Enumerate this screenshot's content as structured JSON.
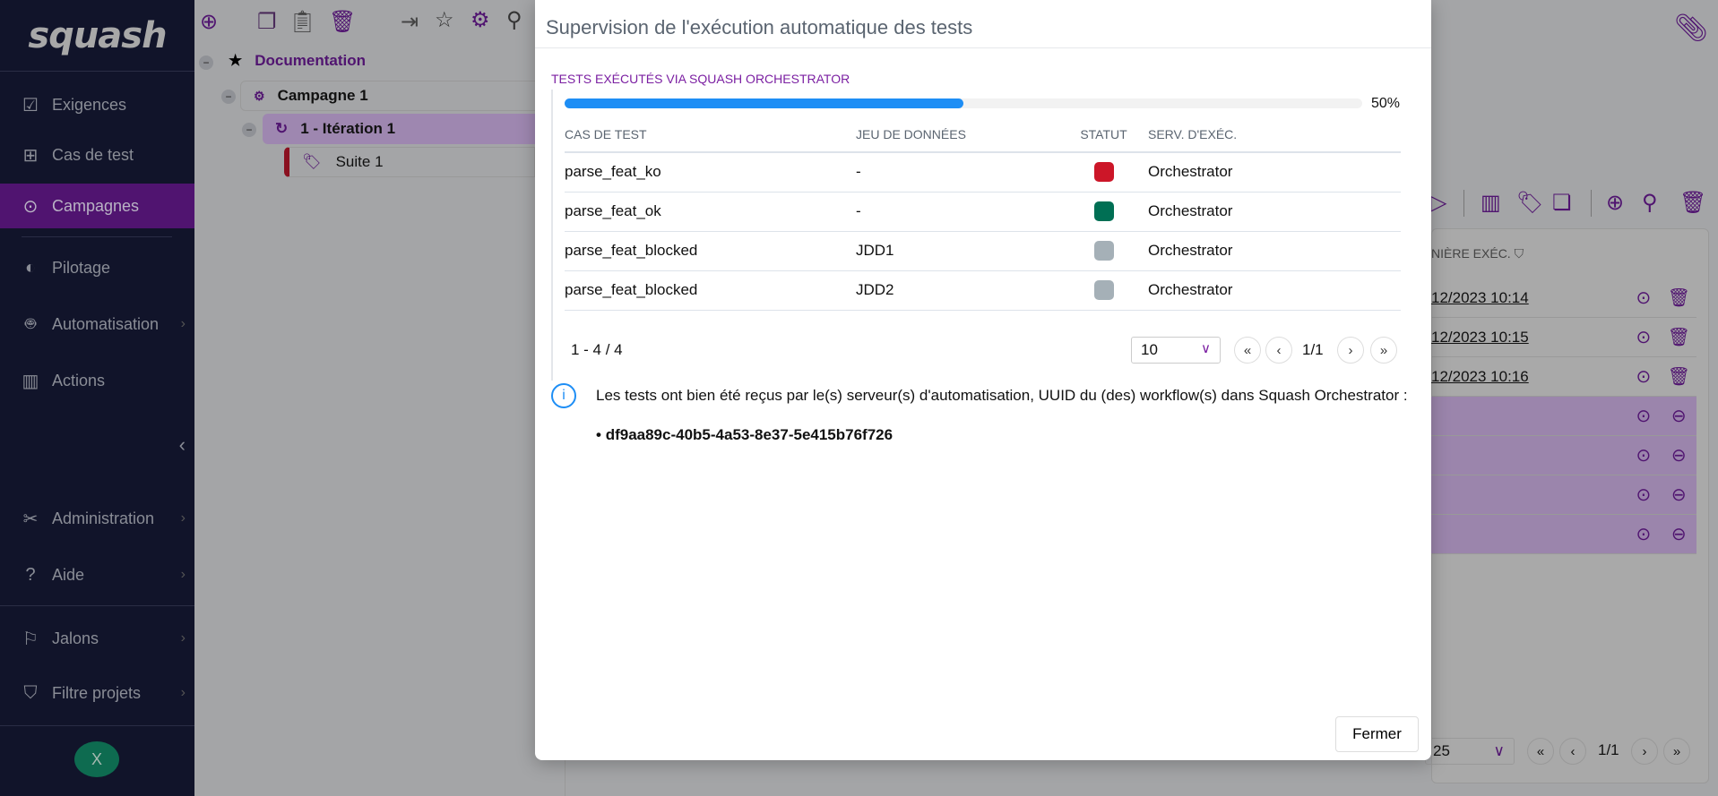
{
  "logo": "squash",
  "sidebar": {
    "items": [
      {
        "label": "Exigences",
        "icon": "checkbox-icon"
      },
      {
        "label": "Cas de test",
        "icon": "tree-icon"
      },
      {
        "label": "Campagnes",
        "icon": "play-circle-icon",
        "active": true
      },
      {
        "label": "Pilotage",
        "icon": "pie-icon"
      },
      {
        "label": "Automatisation",
        "icon": "robot-icon"
      },
      {
        "label": "Actions",
        "icon": "library-icon"
      },
      {
        "label": "Administration",
        "icon": "tools-icon"
      },
      {
        "label": "Aide",
        "icon": "help-icon"
      },
      {
        "label": "Jalons",
        "icon": "flag-icon"
      },
      {
        "label": "Filtre projets",
        "icon": "filter-icon"
      }
    ],
    "avatar": "X",
    "accent": "#501470"
  },
  "tree": {
    "project": "Documentation",
    "campaign": "Campagne 1",
    "iteration": "1 - Itération 1",
    "suite": "Suite 1"
  },
  "background_table": {
    "header": "NIÈRE EXÉC.",
    "dates": [
      "12/2023 10:14",
      "12/2023 10:15",
      "12/2023 10:16"
    ],
    "page_size": "25",
    "page": "1/1"
  },
  "modal": {
    "title": "Supervision de l'exécution automatique des tests",
    "section": "TESTS EXÉCUTÉS VIA SQUASH ORCHESTRATOR",
    "progress": 50,
    "progress_label": "50%",
    "columns": [
      "CAS DE TEST",
      "JEU DE DONNÉES",
      "STATUT",
      "SERV. D'EXÉC."
    ],
    "rows": [
      {
        "test": "parse_feat_ko",
        "dataset": "-",
        "status_color": "#cc1628",
        "server": "Orchestrator"
      },
      {
        "test": "parse_feat_ok",
        "dataset": "-",
        "status_color": "#006f54",
        "server": "Orchestrator"
      },
      {
        "test": "parse_feat_blocked",
        "dataset": "JDD1",
        "status_color": "#a5b0b7",
        "server": "Orchestrator"
      },
      {
        "test": "parse_feat_blocked",
        "dataset": "JDD2",
        "status_color": "#a5b0b7",
        "server": "Orchestrator"
      }
    ],
    "count": "1 - 4 / 4",
    "page_size": "10",
    "page": "1/1",
    "info": "Les tests ont bien été reçus par le(s) serveur(s) d'automatisation, UUID du (des) workflow(s) dans Squash Orchestrator :",
    "uuid": "df9aa89c-40b5-4a53-8e37-5e415b76f726",
    "close": "Fermer"
  }
}
